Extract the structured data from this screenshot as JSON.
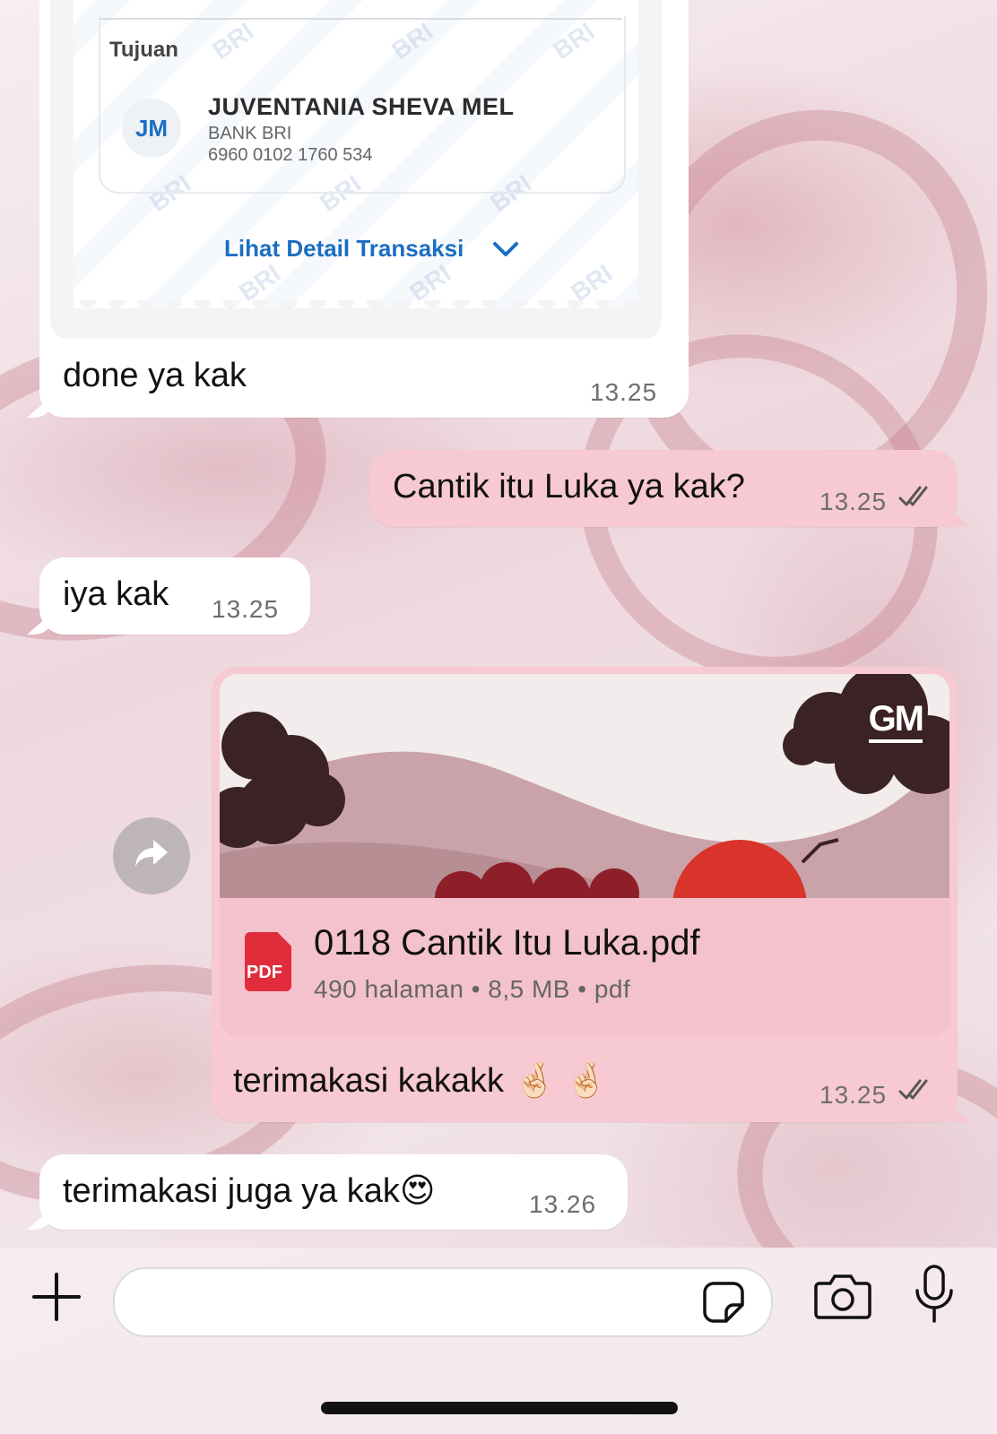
{
  "receipt": {
    "dest_heading": "Tujuan",
    "avatar_initials": "JM",
    "recipient_name": "JUVENTANIA SHEVA MEL",
    "bank": "BANK BRI",
    "account": "6960 0102 1760 534",
    "detail_link": "Lihat Detail Transaksi",
    "watermark": "BRI"
  },
  "messages": [
    {
      "id": "m1",
      "direction": "incoming",
      "text": "done ya kak",
      "time": "13.25"
    },
    {
      "id": "m2",
      "direction": "outgoing",
      "text": "Cantik itu Luka ya kak?",
      "time": "13.25",
      "status": "read"
    },
    {
      "id": "m3",
      "direction": "incoming",
      "text": "iya kak",
      "time": "13.25"
    },
    {
      "id": "m4",
      "direction": "outgoing",
      "caption": "terimakasi kakakk 🤞🏻 🤞🏻",
      "time": "13.25",
      "status": "read",
      "document": {
        "filename": "0118 Cantik Itu Luka.pdf",
        "meta": "490 halaman • 8,5 MB • pdf",
        "icon_label": "PDF",
        "logo": "GM"
      }
    },
    {
      "id": "m5",
      "direction": "incoming",
      "text": "terimakasi juga ya kak😍",
      "time": "13.26"
    }
  ],
  "composer": {
    "placeholder": "",
    "icons": [
      "plus-icon",
      "sticker-icon",
      "camera-icon",
      "microphone-icon"
    ]
  },
  "colors": {
    "incoming": "#ffffff",
    "outgoing": "#f7c9d2",
    "link": "#1b6ec2",
    "pdf": "#e02c3b"
  }
}
